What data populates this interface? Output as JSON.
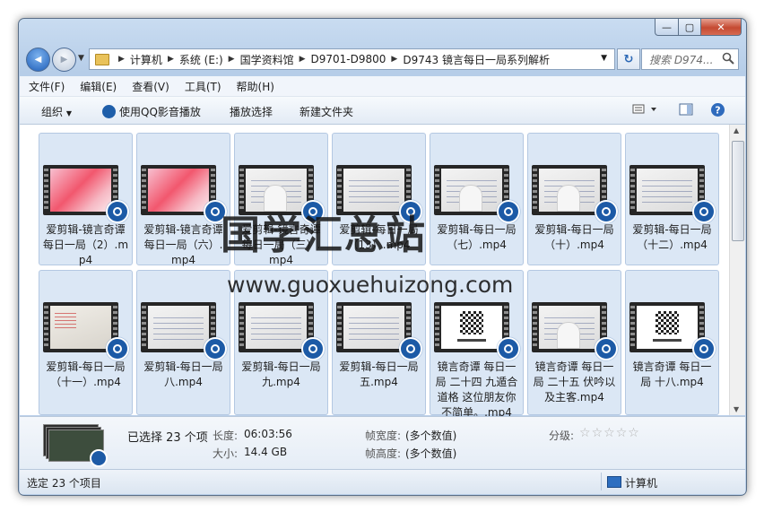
{
  "window": {
    "controls": {
      "minimize": "—",
      "maximize": "▢",
      "close": "✕"
    }
  },
  "nav": {
    "back_icon": "◀",
    "forward_icon": "▶",
    "breadcrumb": [
      "计算机",
      "系统 (E:)",
      "国学资料馆",
      "D9701-D9800",
      "D9743 镜言每日一局系列解析"
    ],
    "search_placeholder": "搜索 D974..."
  },
  "menu": [
    "文件(F)",
    "编辑(E)",
    "查看(V)",
    "工具(T)",
    "帮助(H)"
  ],
  "toolbar": {
    "organize": "组织",
    "play_qq": "使用QQ影音播放",
    "play_selection": "播放选择",
    "new_folder": "新建文件夹"
  },
  "files": [
    {
      "name": "爱剪辑-镜言奇谭每日一局（2）.mp4",
      "thumb": "pink"
    },
    {
      "name": "爱剪辑-镜言奇谭每日一局（六）.mp4",
      "thumb": "pink"
    },
    {
      "name": "爱剪辑-镜言奇谭每日一局（三）.mp4",
      "thumb": "man"
    },
    {
      "name": "爱剪辑-每日一局（13）.mp4",
      "thumb": "board"
    },
    {
      "name": "爱剪辑-每日一局（七）.mp4",
      "thumb": "man"
    },
    {
      "name": "爱剪辑-每日一局（十）.mp4",
      "thumb": "man"
    },
    {
      "name": "爱剪辑-每日一局（十二）.mp4",
      "thumb": "board"
    },
    {
      "name": "爱剪辑-每日一局（十一）.mp4",
      "thumb": "red"
    },
    {
      "name": "爱剪辑-每日一局八.mp4",
      "thumb": "board"
    },
    {
      "name": "爱剪辑-每日一局九.mp4",
      "thumb": "board"
    },
    {
      "name": "爱剪辑-每日一局五.mp4",
      "thumb": "board"
    },
    {
      "name": "镜言奇谭 每日一局 二十四 九遁合道格 这位朋友你不简单。.mp4",
      "thumb": "qr"
    },
    {
      "name": "镜言奇谭 每日一局 二十五 伏吟以及主客.mp4",
      "thumb": "man"
    },
    {
      "name": "镜言奇谭 每日一局 十八.mp4",
      "thumb": "qr"
    }
  ],
  "watermark": {
    "title": "国学汇总站",
    "url": "www.guoxuehuizong.com"
  },
  "details": {
    "selected": "已选择 23 个项",
    "length_label": "长度:",
    "length": "06:03:56",
    "size_label": "大小:",
    "size": "14.4 GB",
    "frame_width_label": "帧宽度:",
    "frame_width": "(多个数值)",
    "frame_height_label": "帧高度:",
    "frame_height": "(多个数值)",
    "rating_label": "分级:",
    "rating": 0
  },
  "status": {
    "left": "选定 23 个项目",
    "right": "计算机"
  }
}
